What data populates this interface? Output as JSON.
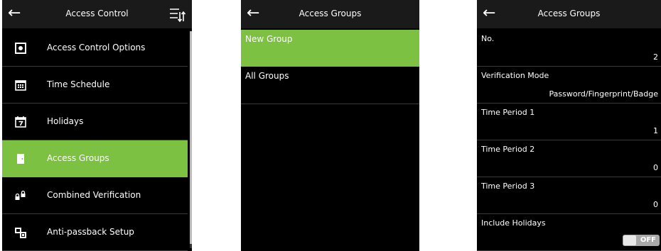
{
  "screen1": {
    "title": "Access Control",
    "items": [
      {
        "label": "Access Control Options",
        "icon": "options-icon"
      },
      {
        "label": "Time Schedule",
        "icon": "calendar-icon"
      },
      {
        "label": "Holidays",
        "icon": "holiday-calendar-icon"
      },
      {
        "label": "Access Groups",
        "icon": "door-icon",
        "selected": true
      },
      {
        "label": "Combined Verification",
        "icon": "locks-icon"
      },
      {
        "label": "Anti-passback Setup",
        "icon": "anti-passback-icon"
      }
    ]
  },
  "screen2": {
    "title": "Access Groups",
    "items": [
      {
        "label": "New Group",
        "selected": true
      },
      {
        "label": "All Groups"
      }
    ]
  },
  "screen3": {
    "title": "Access Groups",
    "fields": [
      {
        "label": "No.",
        "value": "2"
      },
      {
        "label": "Verification Mode",
        "value": "Password/Fingerprint/Badge"
      },
      {
        "label": "Time Period 1",
        "value": "1"
      },
      {
        "label": "Time Period 2",
        "value": "0"
      },
      {
        "label": "Time Period 3",
        "value": "0"
      },
      {
        "label": "Include Holidays",
        "toggle": "OFF"
      }
    ]
  },
  "colors": {
    "accent": "#7dc142",
    "background": "#000000",
    "header": "#1a1a1a"
  }
}
